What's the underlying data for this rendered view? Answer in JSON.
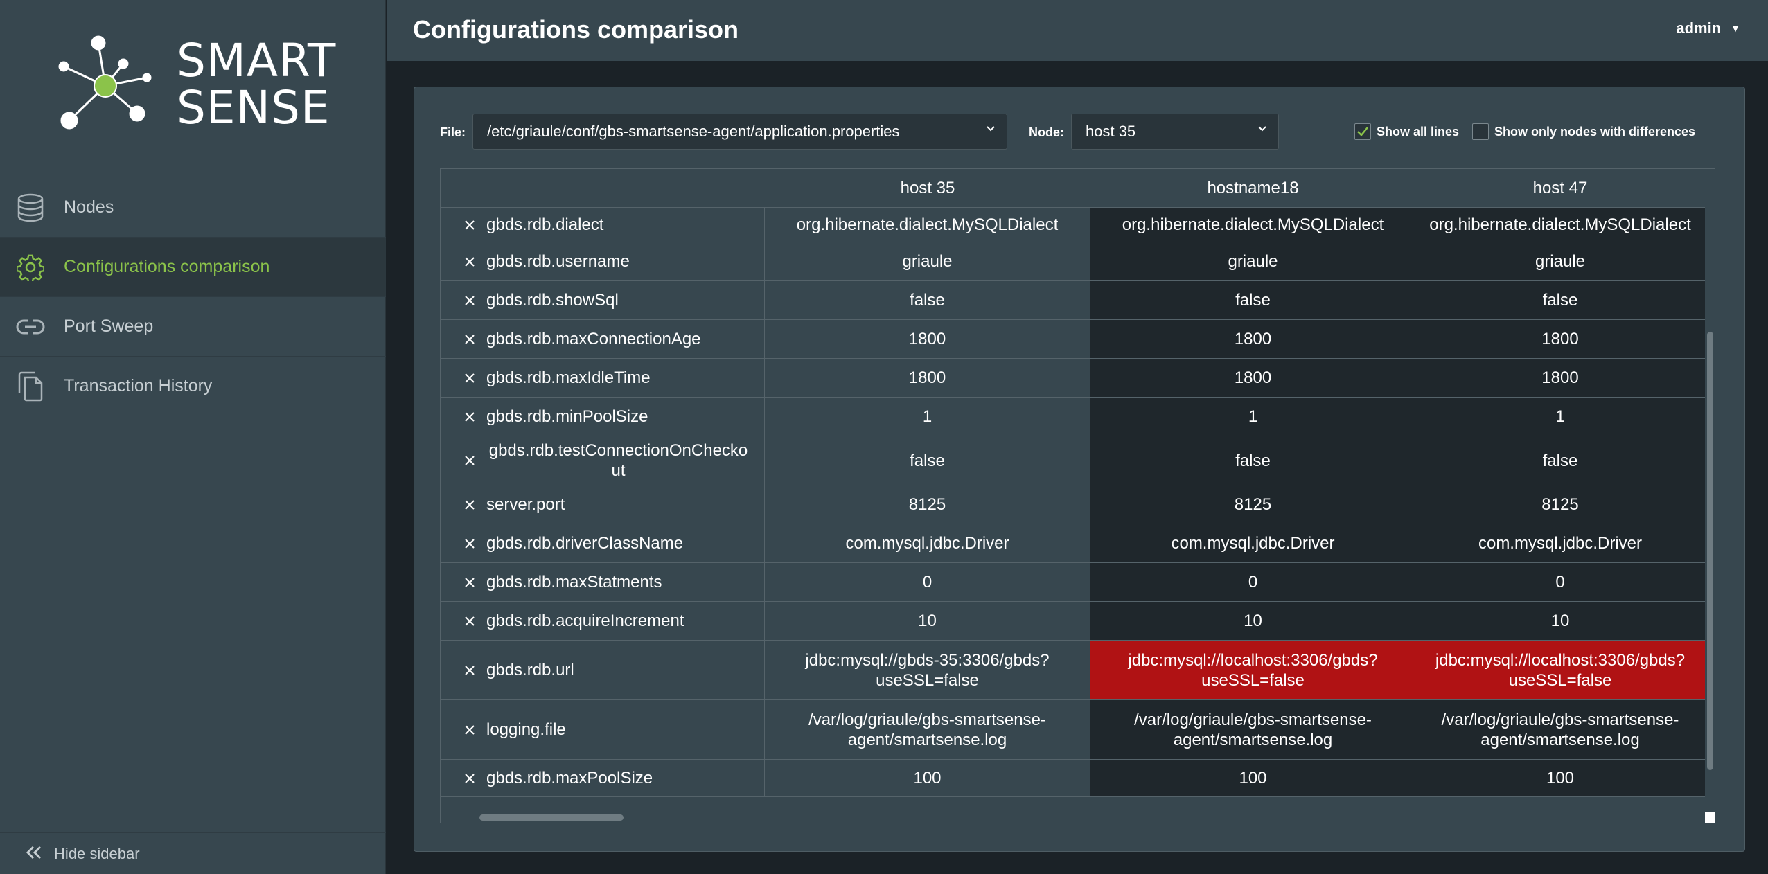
{
  "app": {
    "logo_line1": "SMART",
    "logo_line2": "SENSE",
    "accent_color": "#8bc34a",
    "diff_color": "#b01214"
  },
  "sidebar": {
    "items": [
      {
        "label": "Nodes",
        "icon": "database-icon",
        "active": false
      },
      {
        "label": "Configurations comparison",
        "icon": "gear-icon",
        "active": true
      },
      {
        "label": "Port Sweep",
        "icon": "link-icon",
        "active": false
      },
      {
        "label": "Transaction History",
        "icon": "copy-icon",
        "active": false
      }
    ],
    "hide_label": "Hide sidebar"
  },
  "header": {
    "title": "Configurations comparison",
    "user": "admin"
  },
  "toolbar": {
    "file_label": "File:",
    "file_value": "/etc/griaule/conf/gbs-smartsense-agent/application.properties",
    "node_label": "Node:",
    "node_value": "host 35",
    "show_all_lines_label": "Show all lines",
    "show_all_lines_checked": true,
    "show_only_diff_label": "Show only nodes with differences",
    "show_only_diff_checked": false
  },
  "table": {
    "columns": [
      "",
      "host 35",
      "hostname18",
      "host 47"
    ],
    "rows": [
      {
        "key": "gbds.rdb.dialect",
        "values": [
          "org.hibernate.dialect.MySQLDialect",
          "org.hibernate.dialect.MySQLDialect",
          "org.hibernate.dialect.MySQLDialect"
        ],
        "diff": [
          false,
          false,
          false
        ]
      },
      {
        "key": "gbds.rdb.username",
        "values": [
          "griaule",
          "griaule",
          "griaule"
        ],
        "diff": [
          false,
          false,
          false
        ]
      },
      {
        "key": "gbds.rdb.showSql",
        "values": [
          "false",
          "false",
          "false"
        ],
        "diff": [
          false,
          false,
          false
        ]
      },
      {
        "key": "gbds.rdb.maxConnectionAge",
        "values": [
          "1800",
          "1800",
          "1800"
        ],
        "diff": [
          false,
          false,
          false
        ]
      },
      {
        "key": "gbds.rdb.maxIdleTime",
        "values": [
          "1800",
          "1800",
          "1800"
        ],
        "diff": [
          false,
          false,
          false
        ]
      },
      {
        "key": "gbds.rdb.minPoolSize",
        "values": [
          "1",
          "1",
          "1"
        ],
        "diff": [
          false,
          false,
          false
        ]
      },
      {
        "key": "gbds.rdb.testConnectionOnCheckout",
        "values": [
          "false",
          "false",
          "false"
        ],
        "diff": [
          false,
          false,
          false
        ]
      },
      {
        "key": "server.port",
        "values": [
          "8125",
          "8125",
          "8125"
        ],
        "diff": [
          false,
          false,
          false
        ]
      },
      {
        "key": "gbds.rdb.driverClassName",
        "values": [
          "com.mysql.jdbc.Driver",
          "com.mysql.jdbc.Driver",
          "com.mysql.jdbc.Driver"
        ],
        "diff": [
          false,
          false,
          false
        ]
      },
      {
        "key": "gbds.rdb.maxStatments",
        "values": [
          "0",
          "0",
          "0"
        ],
        "diff": [
          false,
          false,
          false
        ]
      },
      {
        "key": "gbds.rdb.acquireIncrement",
        "values": [
          "10",
          "10",
          "10"
        ],
        "diff": [
          false,
          false,
          false
        ]
      },
      {
        "key": "gbds.rdb.url",
        "values": [
          "jdbc:mysql://gbds-35:3306/gbds?useSSL=false",
          "jdbc:mysql://localhost:3306/gbds?useSSL=false",
          "jdbc:mysql://localhost:3306/gbds?useSSL=false"
        ],
        "diff": [
          false,
          true,
          true
        ]
      },
      {
        "key": "logging.file",
        "values": [
          "/var/log/griaule/gbs-smartsense-agent/smartsense.log",
          "/var/log/griaule/gbs-smartsense-agent/smartsense.log",
          "/var/log/griaule/gbs-smartsense-agent/smartsense.log"
        ],
        "diff": [
          false,
          false,
          false
        ]
      },
      {
        "key": "gbds.rdb.maxPoolSize",
        "values": [
          "100",
          "100",
          "100"
        ],
        "diff": [
          false,
          false,
          false
        ]
      }
    ]
  }
}
